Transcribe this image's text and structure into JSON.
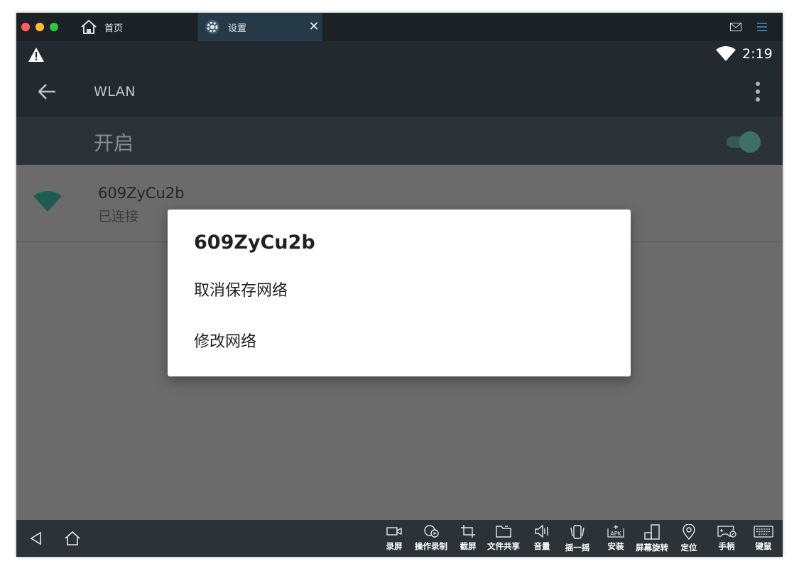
{
  "titlebar": {
    "tabs": [
      {
        "label": "首页",
        "icon": "home-icon"
      },
      {
        "label": "设置",
        "icon": "gear-icon",
        "active": true
      }
    ],
    "right_icons": [
      "mail-icon",
      "menu-icon"
    ]
  },
  "statusbar": {
    "time": "2:19",
    "icons": [
      "warning-icon",
      "wifi-icon"
    ]
  },
  "appbar": {
    "title": "WLAN"
  },
  "switchbar": {
    "label": "开启",
    "enabled": true
  },
  "network": {
    "name": "609ZyCu2b",
    "status": "已连接"
  },
  "dialog": {
    "title": "609ZyCu2b",
    "options": [
      "取消保存网络",
      "修改网络"
    ]
  },
  "toolbar": {
    "items": [
      {
        "label": "录屏",
        "icon": "video-camera-icon"
      },
      {
        "label": "操作录制",
        "icon": "operation-record-icon"
      },
      {
        "label": "截屏",
        "icon": "crop-icon"
      },
      {
        "label": "文件共享",
        "icon": "folder-icon"
      },
      {
        "label": "音量",
        "icon": "volume-icon"
      },
      {
        "label": "摇一摇",
        "icon": "shake-icon"
      },
      {
        "label": "安装",
        "icon": "apk-install-icon"
      },
      {
        "label": "屏幕旋转",
        "icon": "rotate-screen-icon"
      },
      {
        "label": "定位",
        "icon": "location-pin-icon"
      },
      {
        "label": "手柄",
        "icon": "gamepad-icon"
      },
      {
        "label": "键鼠",
        "icon": "keyboard-icon"
      }
    ]
  },
  "colors": {
    "accent": "#3e7064",
    "wifi_signal": "#1e5c4f",
    "dim_overlay": "#6b6b6b"
  }
}
